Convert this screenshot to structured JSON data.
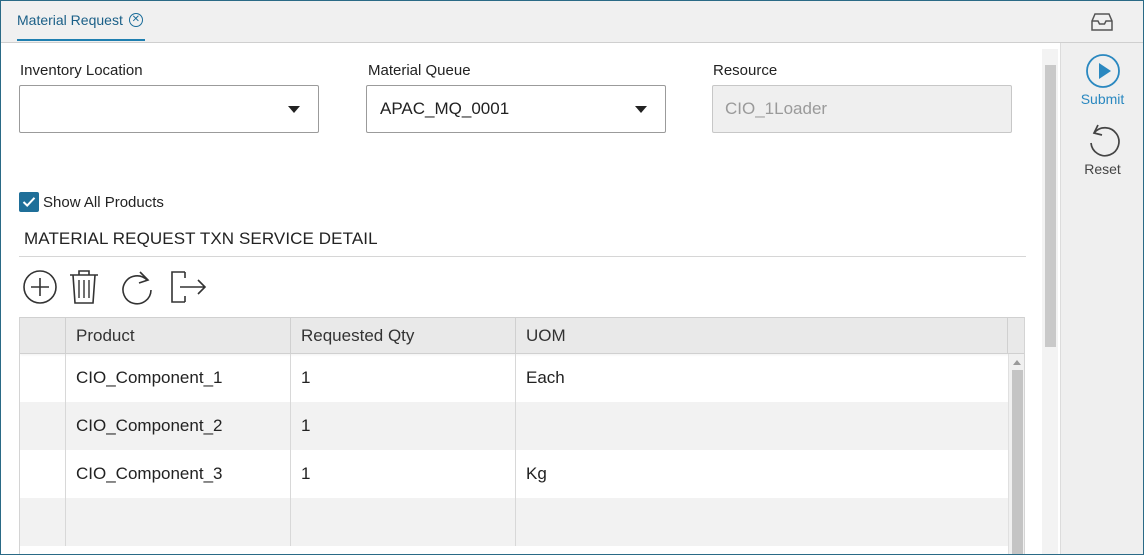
{
  "tab": {
    "label": "Material Request"
  },
  "form": {
    "inventory_location": {
      "label": "Inventory Location",
      "value": ""
    },
    "material_queue": {
      "label": "Material Queue",
      "value": "APAC_MQ_0001"
    },
    "resource": {
      "label": "Resource",
      "value": "CIO_1Loader"
    },
    "show_all_products": {
      "label": "Show All Products",
      "checked": true
    }
  },
  "section": {
    "title": "MATERIAL REQUEST TXN SERVICE DETAIL"
  },
  "toolbar": {
    "icons": [
      "add-icon",
      "delete-icon",
      "refresh-icon",
      "export-icon"
    ]
  },
  "grid": {
    "columns": [
      "Product",
      "Requested Qty",
      "UOM"
    ],
    "rows": [
      {
        "product": "CIO_Component_1",
        "qty": "1",
        "uom": "Each"
      },
      {
        "product": "CIO_Component_2",
        "qty": "1",
        "uom": ""
      },
      {
        "product": "CIO_Component_3",
        "qty": "1",
        "uom": "Kg"
      },
      {
        "product": "",
        "qty": "",
        "uom": ""
      }
    ]
  },
  "actions": {
    "submit": {
      "label": "Submit"
    },
    "reset": {
      "label": "Reset"
    }
  },
  "colors": {
    "accent": "#1f7fb0",
    "border": "#2a6a86"
  }
}
